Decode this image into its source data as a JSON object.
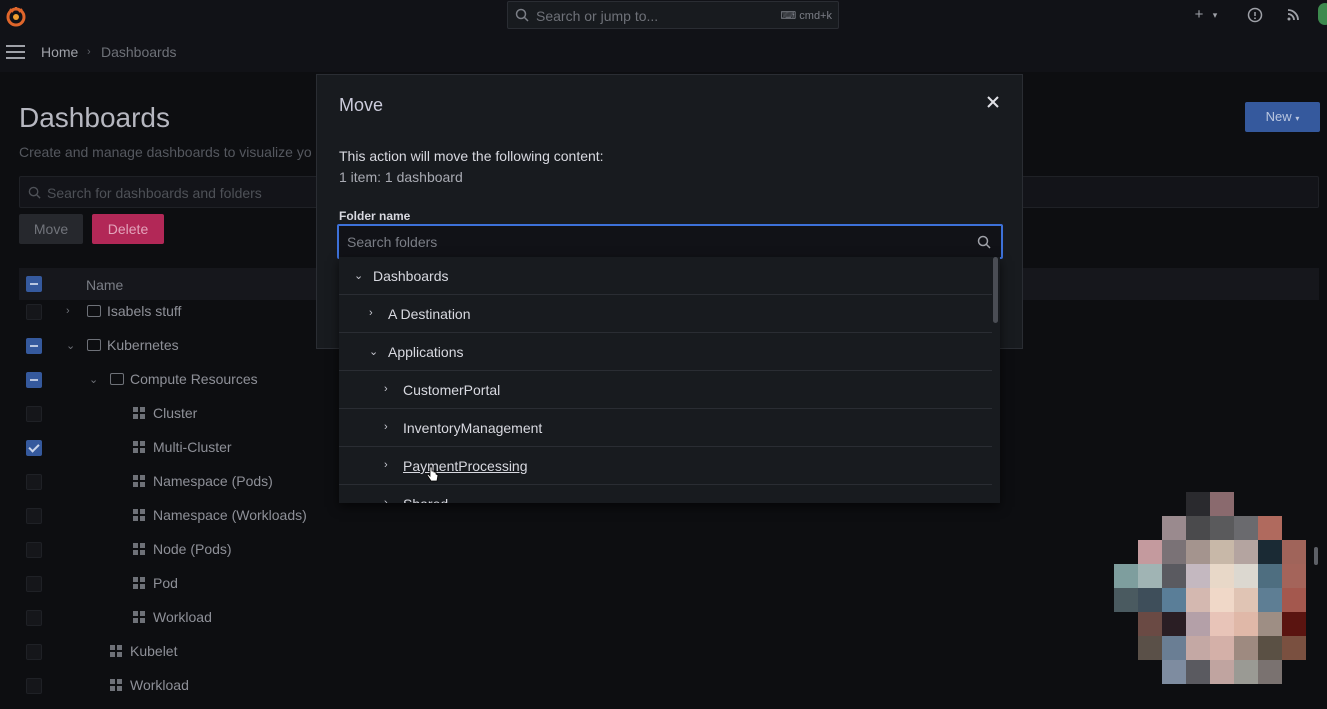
{
  "topbar": {
    "search_placeholder": "Search or jump to...",
    "search_shortcut": "cmd+k",
    "add_icon": "plus-icon",
    "help_icon": "help-icon",
    "news_icon": "rss-icon"
  },
  "breadcrumb": {
    "home": "Home",
    "separator": "›",
    "current": "Dashboards"
  },
  "page": {
    "title": "Dashboards",
    "subtitle": "Create and manage dashboards to visualize yo",
    "new_button": "New",
    "search_placeholder": "Search for dashboards and folders",
    "move_button": "Move",
    "delete_button": "Delete",
    "name_column": "Name",
    "rows": [
      {
        "label": "Isabels stuff",
        "type": "folder",
        "caret": "›",
        "state": "off"
      },
      {
        "label": "Kubernetes",
        "type": "folder",
        "caret": "⌄",
        "state": "ind"
      },
      {
        "label": "Compute Resources",
        "type": "folder",
        "caret": "⌄",
        "state": "ind"
      },
      {
        "label": "Cluster",
        "type": "dashboard",
        "state": "off"
      },
      {
        "label": "Multi-Cluster",
        "type": "dashboard",
        "state": "chk"
      },
      {
        "label": "Namespace (Pods)",
        "type": "dashboard",
        "state": "off"
      },
      {
        "label": "Namespace (Workloads)",
        "type": "dashboard",
        "state": "off"
      },
      {
        "label": "Node (Pods)",
        "type": "dashboard",
        "state": "off"
      },
      {
        "label": "Pod",
        "type": "dashboard",
        "state": "off"
      },
      {
        "label": "Workload",
        "type": "dashboard",
        "state": "off"
      },
      {
        "label": "Kubelet",
        "type": "dashboard",
        "state": "off"
      },
      {
        "label": "Workload",
        "type": "dashboard",
        "state": "off"
      }
    ]
  },
  "modal": {
    "title": "Move",
    "message": "This action will move the following content:",
    "summary": "1 item: 1 dashboard",
    "field_label": "Folder name",
    "folder_search_placeholder": "Search folders",
    "folders": [
      {
        "label": "Dashboards",
        "chevron": "⌄",
        "link": false
      },
      {
        "label": "A Destination",
        "chevron": "›",
        "link": false
      },
      {
        "label": "Applications",
        "chevron": "⌄",
        "link": false
      },
      {
        "label": "CustomerPortal",
        "chevron": "›",
        "link": false
      },
      {
        "label": "InventoryManagement",
        "chevron": "›",
        "link": false
      },
      {
        "label": "PaymentProcessing",
        "chevron": "›",
        "link": true
      },
      {
        "label": "Shared",
        "chevron": "›",
        "link": false
      }
    ]
  },
  "colors": {
    "accent": "#3d71d9",
    "delete": "#b22857",
    "primary": "#35599d"
  }
}
